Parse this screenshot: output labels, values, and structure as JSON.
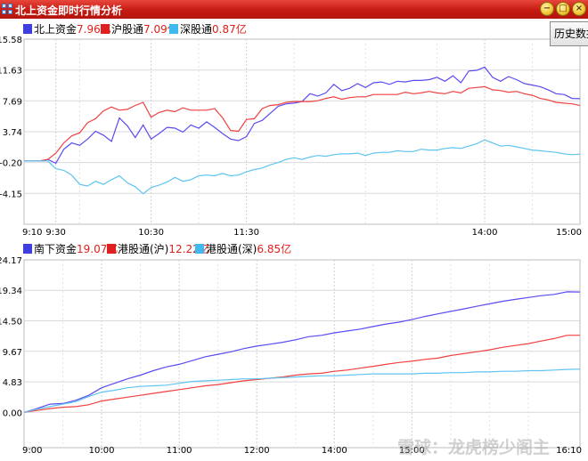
{
  "window": {
    "title": "北上资金即时行情分析",
    "history_button": "历史数据"
  },
  "colors": {
    "blue": "#5a4bf0",
    "red": "#f04040",
    "cyan": "#5ec4f0",
    "titlebar": "#c81e16"
  },
  "top_legend": [
    {
      "name": "北上资金",
      "value": "7.96亿",
      "color": "#3f3fe0"
    },
    {
      "name": "沪股通",
      "value": "7.09亿",
      "color": "#e02020"
    },
    {
      "name": "深股通",
      "value": "0.87亿",
      "color": "#40b8f0"
    }
  ],
  "bottom_legend": [
    {
      "name": "南下资金",
      "value": "19.07亿",
      "color": "#3f3fe0"
    },
    {
      "name": "港股通(沪)",
      "value": "12.22亿",
      "color": "#e02020"
    },
    {
      "name": "港股通(深)",
      "value": "6.85亿",
      "color": "#40b8f0"
    }
  ],
  "watermark": "雪球：龙虎榜少阁主",
  "chart_data": [
    {
      "type": "line",
      "title": "北上资金",
      "ylabel": "亿",
      "yticks": [
        15.58,
        11.63,
        7.69,
        3.74,
        -0.2,
        -4.15
      ],
      "ytick_labels": [
        "15.58",
        "11.63",
        "7.69",
        "3.74",
        "-0.20",
        "-4.15"
      ],
      "ylim": [
        -8.1,
        15.58
      ],
      "xlim": [
        -20,
        330
      ],
      "xtick_labels": [
        "9:10",
        "9:30",
        "10:30",
        "11:30",
        "14:00",
        "15:00"
      ],
      "xtick_minutes": [
        -20,
        0,
        60,
        120,
        270,
        330
      ],
      "series": [
        {
          "name": "北上资金",
          "color": "#5a4bf0",
          "x": [
            -20,
            -10,
            -5,
            0,
            5,
            10,
            15,
            20,
            25,
            30,
            35,
            40,
            45,
            50,
            55,
            60,
            65,
            70,
            75,
            80,
            85,
            90,
            95,
            100,
            105,
            110,
            115,
            120,
            125,
            130,
            135,
            140,
            145,
            150,
            155,
            160,
            165,
            170,
            175,
            180,
            185,
            190,
            195,
            200,
            205,
            210,
            215,
            220,
            225,
            230,
            235,
            240,
            245,
            250,
            255,
            260,
            265,
            270,
            275,
            280,
            285,
            290,
            295,
            300,
            305,
            310,
            315,
            320,
            325,
            330
          ],
          "y": [
            0,
            0,
            0.2,
            -0.3,
            1.5,
            2.3,
            2.0,
            2.8,
            3.8,
            3.3,
            2.5,
            5.5,
            4.5,
            3.0,
            4.6,
            2.8,
            3.5,
            4.3,
            4.2,
            3.7,
            4.6,
            4.2,
            5.0,
            4.3,
            3.5,
            2.8,
            2.6,
            3.1,
            4.8,
            5.2,
            6.1,
            7.0,
            7.3,
            7.4,
            7.6,
            8.6,
            8.3,
            8.7,
            9.8,
            9.0,
            9.3,
            9.9,
            9.4,
            10.0,
            10.1,
            9.8,
            10.2,
            10.1,
            10.3,
            10.3,
            10.4,
            10.7,
            10.2,
            10.9,
            10.0,
            11.5,
            11.6,
            12.0,
            10.7,
            10.2,
            10.8,
            10.4,
            9.9,
            9.7,
            9.5,
            9.1,
            8.6,
            8.5,
            8.0,
            7.96
          ]
        },
        {
          "name": "沪股通",
          "color": "#f04040",
          "x": [
            -20,
            -10,
            -5,
            0,
            5,
            10,
            15,
            20,
            25,
            30,
            35,
            40,
            45,
            50,
            55,
            60,
            65,
            70,
            75,
            80,
            85,
            90,
            95,
            100,
            105,
            110,
            115,
            120,
            125,
            130,
            135,
            140,
            145,
            150,
            155,
            160,
            165,
            170,
            175,
            180,
            185,
            190,
            195,
            200,
            205,
            210,
            215,
            220,
            225,
            230,
            235,
            240,
            245,
            250,
            255,
            260,
            265,
            270,
            275,
            280,
            285,
            290,
            295,
            300,
            305,
            310,
            315,
            320,
            325,
            330
          ],
          "y": [
            0,
            0,
            0.2,
            1.0,
            2.3,
            3.2,
            3.6,
            4.9,
            5.4,
            6.4,
            6.9,
            6.5,
            6.6,
            7.1,
            7.5,
            5.6,
            6.2,
            6.5,
            6.3,
            6.8,
            6.5,
            6.5,
            6.5,
            6.7,
            5.5,
            3.9,
            3.8,
            5.3,
            5.4,
            6.7,
            7.1,
            7.2,
            7.5,
            7.6,
            7.6,
            7.6,
            7.7,
            8.0,
            8.2,
            7.9,
            8.1,
            8.2,
            8.2,
            8.5,
            8.5,
            8.5,
            8.5,
            8.8,
            8.6,
            8.7,
            8.9,
            8.7,
            8.6,
            8.9,
            8.7,
            9.3,
            9.4,
            9.5,
            9.1,
            9.0,
            8.8,
            8.9,
            8.6,
            8.4,
            8.0,
            7.8,
            7.5,
            7.4,
            7.3,
            7.09
          ]
        },
        {
          "name": "深股通",
          "color": "#5ec4f0",
          "x": [
            -20,
            -10,
            -5,
            0,
            5,
            10,
            15,
            20,
            25,
            30,
            35,
            40,
            45,
            50,
            55,
            60,
            65,
            70,
            75,
            80,
            85,
            90,
            95,
            100,
            105,
            110,
            115,
            120,
            125,
            130,
            135,
            140,
            145,
            150,
            155,
            160,
            165,
            170,
            175,
            180,
            185,
            190,
            195,
            200,
            205,
            210,
            215,
            220,
            225,
            230,
            235,
            240,
            245,
            250,
            255,
            260,
            265,
            270,
            275,
            280,
            285,
            290,
            295,
            300,
            305,
            310,
            315,
            320,
            325,
            330
          ],
          "y": [
            0,
            0,
            0,
            -1.0,
            -1.2,
            -1.8,
            -3.0,
            -3.2,
            -2.6,
            -3.0,
            -2.4,
            -1.9,
            -2.8,
            -3.3,
            -4.2,
            -3.4,
            -3.1,
            -2.7,
            -2.1,
            -2.6,
            -2.4,
            -1.9,
            -1.8,
            -1.9,
            -1.6,
            -1.9,
            -1.8,
            -1.4,
            -1.1,
            -0.9,
            -0.5,
            -0.2,
            0.2,
            0.4,
            0.2,
            0.5,
            0.7,
            0.6,
            0.8,
            0.9,
            0.9,
            1.0,
            0.7,
            1.0,
            1.1,
            1.1,
            1.3,
            1.2,
            1.2,
            1.5,
            1.4,
            1.4,
            1.6,
            1.7,
            1.6,
            1.9,
            2.2,
            2.7,
            2.3,
            1.9,
            2.0,
            1.8,
            1.6,
            1.4,
            1.3,
            1.2,
            1.1,
            0.9,
            0.8,
            0.87
          ]
        }
      ]
    },
    {
      "type": "line",
      "title": "南下资金",
      "ylabel": "亿",
      "yticks": [
        24.17,
        19.34,
        14.5,
        9.67,
        4.83,
        0
      ],
      "ytick_labels": [
        "24.17",
        "19.34",
        "14.50",
        "9.67",
        "4.83",
        "0.00"
      ],
      "ylim": [
        -5.6,
        24.17
      ],
      "xlim": [
        0,
        430
      ],
      "xtick_labels": [
        "9:00",
        "10:00",
        "11:00",
        "12:00",
        "14:00",
        "15:00",
        "16:10"
      ],
      "xtick_minutes": [
        0,
        60,
        120,
        180,
        240,
        300,
        430
      ],
      "series": [
        {
          "name": "南下资金",
          "color": "#5a4bf0",
          "x": [
            0,
            10,
            20,
            30,
            40,
            50,
            60,
            70,
            80,
            90,
            100,
            110,
            120,
            130,
            140,
            150,
            160,
            170,
            180,
            190,
            200,
            210,
            220,
            230,
            240,
            250,
            260,
            270,
            280,
            290,
            300,
            310,
            320,
            330,
            340,
            350,
            360,
            370,
            380,
            390,
            400,
            410,
            420,
            430
          ],
          "y": [
            0,
            0.6,
            1.3,
            1.4,
            1.9,
            2.7,
            3.9,
            4.6,
            5.3,
            5.9,
            6.6,
            7.2,
            7.6,
            8.2,
            8.8,
            9.2,
            9.6,
            10.1,
            10.5,
            10.8,
            11.1,
            11.5,
            12.0,
            12.2,
            12.6,
            12.9,
            13.2,
            13.6,
            14.0,
            14.3,
            14.7,
            15.2,
            15.6,
            16.0,
            16.4,
            16.8,
            17.2,
            17.6,
            17.9,
            18.2,
            18.5,
            18.7,
            19.1,
            19.07
          ]
        },
        {
          "name": "港股通(沪)",
          "color": "#f04040",
          "x": [
            0,
            10,
            20,
            30,
            40,
            50,
            60,
            70,
            80,
            90,
            100,
            110,
            120,
            130,
            140,
            150,
            160,
            170,
            180,
            190,
            200,
            210,
            220,
            230,
            240,
            250,
            260,
            270,
            280,
            290,
            300,
            310,
            320,
            330,
            340,
            350,
            360,
            370,
            380,
            390,
            400,
            410,
            420,
            430
          ],
          "y": [
            0,
            0.3,
            0.6,
            0.8,
            0.9,
            1.2,
            1.8,
            2.1,
            2.4,
            2.7,
            3.0,
            3.3,
            3.6,
            3.9,
            4.2,
            4.4,
            4.7,
            5.0,
            5.2,
            5.4,
            5.6,
            5.9,
            6.1,
            6.2,
            6.5,
            6.7,
            7.0,
            7.3,
            7.6,
            7.9,
            8.1,
            8.4,
            8.6,
            9.0,
            9.3,
            9.6,
            9.9,
            10.3,
            10.6,
            10.9,
            11.3,
            11.7,
            12.2,
            12.22
          ]
        },
        {
          "name": "港股通(深)",
          "color": "#5ec4f0",
          "x": [
            0,
            10,
            20,
            30,
            40,
            50,
            60,
            70,
            80,
            90,
            100,
            110,
            120,
            130,
            140,
            150,
            160,
            170,
            180,
            190,
            200,
            210,
            220,
            230,
            240,
            250,
            260,
            270,
            280,
            290,
            300,
            310,
            320,
            330,
            340,
            350,
            360,
            370,
            380,
            390,
            400,
            410,
            420,
            430
          ],
          "y": [
            0,
            0.5,
            0.9,
            1.3,
            1.7,
            2.5,
            3.2,
            3.5,
            3.9,
            4.1,
            4.2,
            4.3,
            4.6,
            4.9,
            5.0,
            5.1,
            5.2,
            5.3,
            5.3,
            5.4,
            5.5,
            5.6,
            5.7,
            5.8,
            5.8,
            5.9,
            6.0,
            6.1,
            6.1,
            6.1,
            6.1,
            6.2,
            6.2,
            6.3,
            6.3,
            6.4,
            6.4,
            6.5,
            6.5,
            6.6,
            6.6,
            6.7,
            6.8,
            6.85
          ]
        }
      ]
    }
  ]
}
